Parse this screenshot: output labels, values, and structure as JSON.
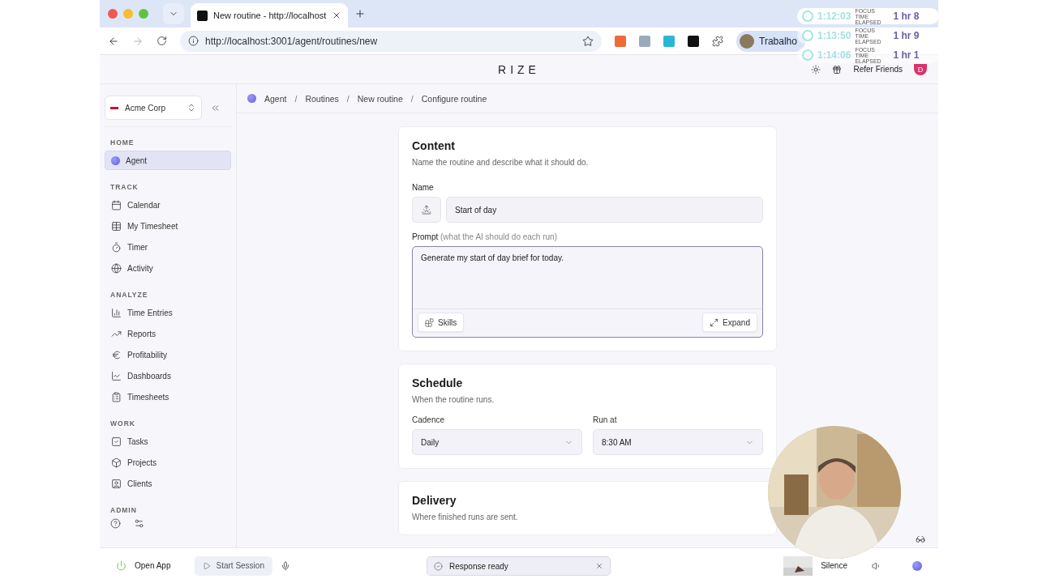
{
  "browser": {
    "tab_title": "New routine - http://localhost",
    "url": "http://localhost:3001/agent/routines/new",
    "profile": "Trabalho"
  },
  "focus_timers": [
    {
      "time": "1:12:03",
      "label": "FOCUS TIME ELAPSED",
      "total": "1 hr 8",
      "selected": true
    },
    {
      "time": "1:13:50",
      "label": "FOCUS TIME ELAPSED",
      "total": "1 hr 9",
      "selected": false
    },
    {
      "time": "1:14:06",
      "label": "FOCUS TIME ELAPSED",
      "total": "1 hr 1",
      "selected": false
    }
  ],
  "app_header": {
    "logo": "RIZE",
    "refer": "Refer Friends",
    "avatar": "D"
  },
  "sidebar": {
    "workspace": "Acme Corp",
    "sections": [
      {
        "title": "HOME",
        "items": [
          {
            "label": "Agent",
            "selected": true
          }
        ]
      },
      {
        "title": "TRACK",
        "items": [
          {
            "label": "Calendar",
            "selected": false
          },
          {
            "label": "My Timesheet",
            "selected": false
          },
          {
            "label": "Timer",
            "selected": false
          },
          {
            "label": "Activity",
            "selected": false
          }
        ]
      },
      {
        "title": "ANALYZE",
        "items": [
          {
            "label": "Time Entries",
            "selected": false
          },
          {
            "label": "Reports",
            "selected": false
          },
          {
            "label": "Profitability",
            "selected": false
          },
          {
            "label": "Dashboards",
            "selected": false
          },
          {
            "label": "Timesheets",
            "selected": false
          }
        ]
      },
      {
        "title": "WORK",
        "items": [
          {
            "label": "Tasks",
            "selected": false
          },
          {
            "label": "Projects",
            "selected": false
          },
          {
            "label": "Clients",
            "selected": false
          }
        ]
      },
      {
        "title": "ADMIN"
      }
    ]
  },
  "breadcrumb": {
    "separator": "/",
    "items": [
      "Agent",
      "Routines",
      "New routine",
      "Configure routine"
    ]
  },
  "content": {
    "title": "Content",
    "description": "Name the routine and describe what it should do.",
    "name_label": "Name",
    "name_value": "Start of day",
    "prompt_label": "Prompt",
    "prompt_hint": "(what the AI should do each run)",
    "prompt_value": "Generate my start of day brief for today.",
    "skills": "Skills",
    "expand": "Expand"
  },
  "schedule": {
    "title": "Schedule",
    "description": "When the routine runs.",
    "fields": [
      {
        "label": "Cadence",
        "value": "Daily"
      },
      {
        "label": "Run at",
        "value": "8:30 AM"
      }
    ]
  },
  "delivery": {
    "title": "Delivery",
    "description": "Where finished runs are sent."
  },
  "bottom_bar": {
    "open_app": "Open App",
    "start_session": "Start Session",
    "toast": "Response ready",
    "sound": "Silence"
  }
}
